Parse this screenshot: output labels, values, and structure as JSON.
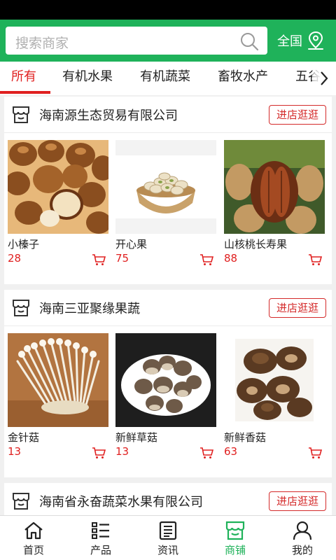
{
  "colors": {
    "brand_green": "#1fb25a",
    "accent_red": "#e02020"
  },
  "header": {
    "search_placeholder": "搜索商家",
    "search_icon": "search-icon",
    "region_label": "全国",
    "region_icon": "location-pin-icon"
  },
  "tabs": [
    {
      "label": "所有",
      "active": true
    },
    {
      "label": "有机水果"
    },
    {
      "label": "有机蔬菜"
    },
    {
      "label": "畜牧水产"
    },
    {
      "label": "五谷"
    }
  ],
  "shops": [
    {
      "name": "海南源生态贸易有限公司",
      "button": "进店逛逛",
      "products": [
        {
          "name": "小榛子",
          "price": "28",
          "image": "hazelnuts"
        },
        {
          "name": "开心果",
          "price": "75",
          "image": "pistachios"
        },
        {
          "name": "山核桃长寿果",
          "price": "88",
          "image": "pecans"
        }
      ]
    },
    {
      "name": "海南三亚聚缘果蔬",
      "button": "进店逛逛",
      "products": [
        {
          "name": "金针菇",
          "price": "13",
          "image": "enoki-mushrooms"
        },
        {
          "name": "新鲜草菇",
          "price": "13",
          "image": "straw-mushrooms"
        },
        {
          "name": "新鲜香菇",
          "price": "63",
          "image": "shiitake-mushrooms"
        }
      ]
    },
    {
      "name": "海南省永奋蔬菜水果有限公司",
      "button": "进店逛逛",
      "products": []
    }
  ],
  "bottom_nav": [
    {
      "label": "首页",
      "icon": "home-icon"
    },
    {
      "label": "产品",
      "icon": "list-icon"
    },
    {
      "label": "资讯",
      "icon": "news-icon"
    },
    {
      "label": "商铺",
      "icon": "store-icon",
      "active": true
    },
    {
      "label": "我的",
      "icon": "user-icon"
    }
  ]
}
